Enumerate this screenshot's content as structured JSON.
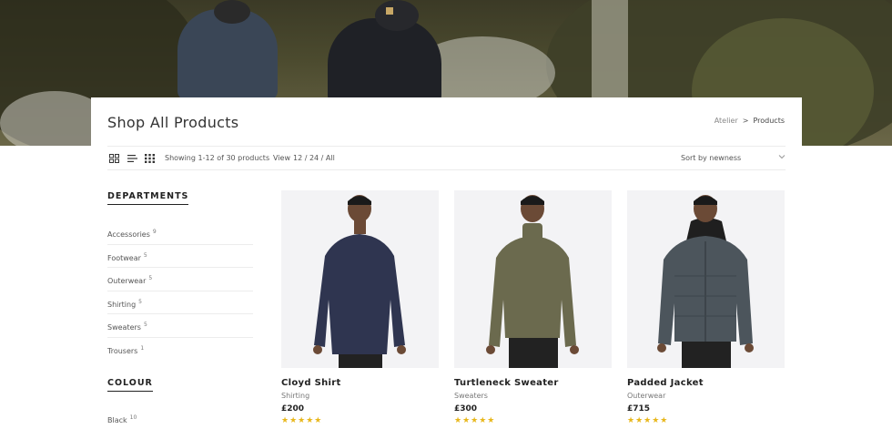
{
  "header": {
    "title": "Shop All Products",
    "breadcrumb": {
      "root": "Atelier",
      "separator": ">",
      "current": "Products"
    }
  },
  "toolbar": {
    "view_icons": [
      "grid-large-icon",
      "list-icon",
      "grid-small-icon"
    ],
    "showing_text": "Showing 1-12 of 30 products",
    "view_label": "View",
    "view_options": "12 / 24 / All",
    "sort_label": "Sort by newness"
  },
  "sidebar": {
    "departments_title": "DEPARTMENTS",
    "departments": [
      {
        "label": "Accessories",
        "count": "9"
      },
      {
        "label": "Footwear",
        "count": "5"
      },
      {
        "label": "Outerwear",
        "count": "5"
      },
      {
        "label": "Shirting",
        "count": "5"
      },
      {
        "label": "Sweaters",
        "count": "5"
      },
      {
        "label": "Trousers",
        "count": "1"
      }
    ],
    "colour_title": "COLOUR",
    "colours": [
      {
        "label": "Black",
        "count": "10"
      }
    ]
  },
  "products": [
    {
      "name": "Cloyd Shirt",
      "category": "Shirting",
      "price": "£200",
      "stars": "★★★★★",
      "rating": 5,
      "garment_color": "#2f3550"
    },
    {
      "name": "Turtleneck Sweater",
      "category": "Sweaters",
      "price": "£300",
      "stars": "★★★★★",
      "rating": 5,
      "garment_color": "#6b6a4e"
    },
    {
      "name": "Padded Jacket",
      "category": "Outerwear",
      "price": "£715",
      "stars": "★★★★★",
      "rating": 5,
      "garment_color": "#4c555c"
    }
  ],
  "colors": {
    "star": "#e8b71c",
    "text_dark": "#222222",
    "text_muted": "#777777",
    "divider": "#ececec",
    "image_bg": "#f3f3f5"
  }
}
